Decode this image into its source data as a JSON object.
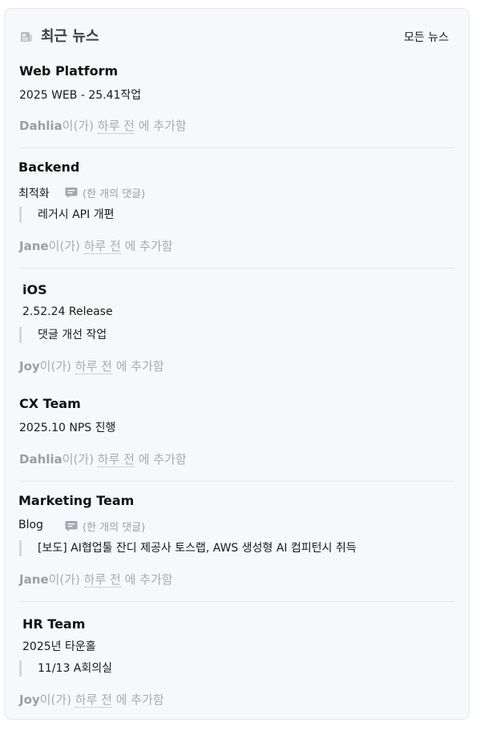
{
  "header": {
    "title": "최근 뉴스",
    "all_link": "모든 뉴스",
    "icon": "news-icon"
  },
  "meta_text": {
    "suffix_ga": "이(가)",
    "relative_time": "하루 전",
    "added_suffix": "에 추가함"
  },
  "items": [
    {
      "title": "Web Platform",
      "body": "2025 WEB - 25.41작업",
      "comment": "",
      "quote": "",
      "author": "Dahlia"
    },
    {
      "title": "Backend",
      "body": "최적화",
      "comment": "(한 개의 댓글)",
      "quote": "레거시 API 개편",
      "author": "Jane"
    },
    {
      "title": "iOS",
      "body": "2.52.24 Release",
      "comment": "",
      "quote": "댓글 개선 작업",
      "author": "Joy"
    },
    {
      "title": "CX Team",
      "body": "2025.10 NPS 진행",
      "comment": "",
      "quote": "",
      "author": "Dahlia"
    },
    {
      "title": "Marketing Team",
      "body": "Blog",
      "comment": "(한 개의 댓글)",
      "quote": "[보도] AI협업툴 잔디 제공사 토스랩, AWS 생성형 AI 컴피턴시 취득",
      "author": "Jane"
    },
    {
      "title": "HR Team",
      "body": "2025년 타운홀",
      "comment": "",
      "quote": "11/13 A회의실",
      "author": "Joy"
    }
  ]
}
